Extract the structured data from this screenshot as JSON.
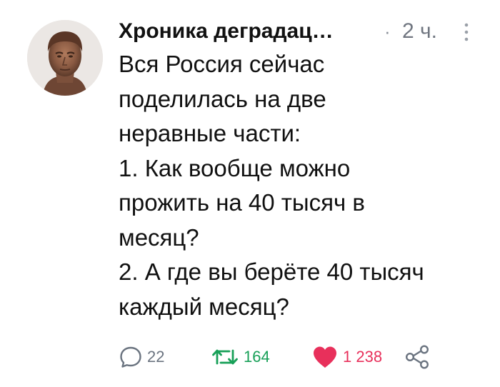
{
  "post": {
    "author": "Хроника деградац…",
    "separator": "·",
    "time": "2 ч.",
    "text_lines": [
      "Вся Россия сейчас",
      "поделилась на две",
      "неравные части:",
      "1. Как вообще можно",
      "прожить на 40 тысяч в",
      "месяц?",
      "2. А где вы берёте 40 тысяч",
      "каждый месяц?"
    ],
    "actions": {
      "replies": "22",
      "reposts": "164",
      "likes": "1 238"
    }
  },
  "colors": {
    "reply": "#6b7480",
    "repost": "#18a058",
    "like": "#e8305b",
    "share": "#6b7480"
  },
  "icons": {
    "avatar": "roman-bust-portrait",
    "more": "vertical-dots-icon",
    "reply": "speech-bubble-icon",
    "repost": "repost-arrows-icon",
    "like": "heart-icon",
    "share": "share-nodes-icon"
  }
}
